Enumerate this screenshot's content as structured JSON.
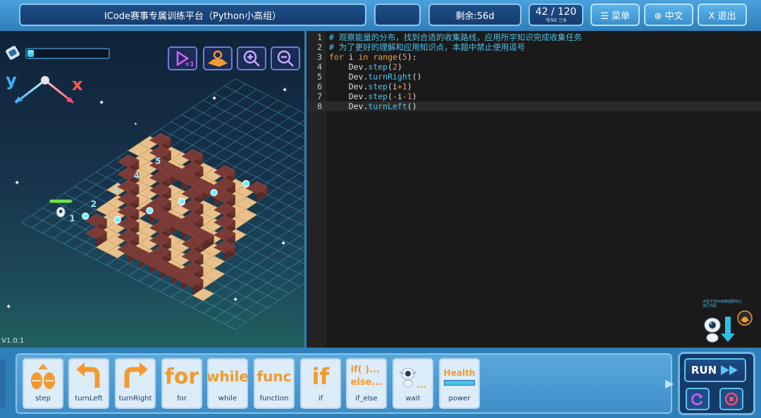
{
  "header": {
    "title": "ICode赛事专属训练平台（Python小高组）",
    "blank_label": "",
    "time_remaining": "剩余:56d",
    "progress": {
      "main": "42 / 120",
      "sub": "今50  三6"
    },
    "menu_label": "☰ 菜单",
    "lang_label": "⊕ 中文",
    "exit_label": "X 退出"
  },
  "game": {
    "energy_fraction": 0.08,
    "axis_x": "x",
    "axis_y": "y",
    "version": "V1.0.1",
    "controls": [
      "speed-icon",
      "map-icon",
      "zoom-in-icon",
      "zoom-out-icon"
    ],
    "row_labels": [
      "1",
      "2",
      "3",
      "4",
      "5"
    ]
  },
  "editor": {
    "lines": [
      {
        "n": "1",
        "parts": [
          {
            "t": "# 观察能量的分布，找到合适的收集路线，应用所学知识完成收集任务",
            "c": "c-comment"
          }
        ]
      },
      {
        "n": "2",
        "parts": [
          {
            "t": "# 为了更好的理解和应用知识点，本题中禁止使用逗号",
            "c": "c-comment"
          }
        ]
      },
      {
        "n": "3",
        "parts": [
          {
            "t": "for",
            "c": "c-kw"
          },
          {
            "t": " i ",
            "c": "c-obj"
          },
          {
            "t": "in",
            "c": "c-kw"
          },
          {
            "t": " ",
            "c": "c-obj"
          },
          {
            "t": "range",
            "c": "c-kw"
          },
          {
            "t": "(",
            "c": "c-obj"
          },
          {
            "t": "5",
            "c": "c-num"
          },
          {
            "t": "):",
            "c": "c-obj"
          }
        ]
      },
      {
        "n": "4",
        "parts": [
          {
            "t": "    Dev.",
            "c": "c-obj"
          },
          {
            "t": "step",
            "c": "c-fn"
          },
          {
            "t": "(",
            "c": "c-obj"
          },
          {
            "t": "2",
            "c": "c-num"
          },
          {
            "t": ")",
            "c": "c-obj"
          }
        ]
      },
      {
        "n": "5",
        "parts": [
          {
            "t": "    Dev.",
            "c": "c-obj"
          },
          {
            "t": "turnRight",
            "c": "c-fn"
          },
          {
            "t": "()",
            "c": "c-obj"
          }
        ]
      },
      {
        "n": "6",
        "parts": [
          {
            "t": "    Dev.",
            "c": "c-obj"
          },
          {
            "t": "step",
            "c": "c-fn"
          },
          {
            "t": "(i",
            "c": "c-obj"
          },
          {
            "t": "+",
            "c": "c-op"
          },
          {
            "t": "1",
            "c": "c-num"
          },
          {
            "t": ")",
            "c": "c-obj"
          }
        ]
      },
      {
        "n": "7",
        "parts": [
          {
            "t": "    Dev.",
            "c": "c-obj"
          },
          {
            "t": "step",
            "c": "c-fn"
          },
          {
            "t": "(",
            "c": "c-obj"
          },
          {
            "t": "-",
            "c": "c-op"
          },
          {
            "t": "i",
            "c": "c-obj"
          },
          {
            "t": "-",
            "c": "c-op"
          },
          {
            "t": "1",
            "c": "c-num"
          },
          {
            "t": ")",
            "c": "c-obj"
          }
        ]
      },
      {
        "n": "8",
        "parts": [
          {
            "t": "    Dev.",
            "c": "c-obj"
          },
          {
            "t": "turnLeft",
            "c": "c-fn"
          },
          {
            "t": "()",
            "c": "c-obj"
          }
        ]
      }
    ],
    "active_line": "8",
    "helper_text": "点击下方RUN按钮即可以运行代码"
  },
  "palette": {
    "blocks": [
      {
        "id": "step",
        "art": "",
        "label": "step"
      },
      {
        "id": "turnLeft",
        "art": "",
        "label": "turnLeft"
      },
      {
        "id": "turnRight",
        "art": "",
        "label": "turnRight"
      },
      {
        "id": "for",
        "art": "for",
        "label": "for"
      },
      {
        "id": "while",
        "art": "while",
        "label": "while"
      },
      {
        "id": "function",
        "art": "func",
        "label": "function"
      },
      {
        "id": "if",
        "art": "if",
        "label": "if"
      },
      {
        "id": "if_else",
        "art": "if( )...\nelse...",
        "label": "if_else"
      },
      {
        "id": "wait",
        "art": "",
        "label": "wait"
      },
      {
        "id": "power",
        "art": "Health",
        "label": "power"
      }
    ],
    "run_label": "RUN"
  },
  "colors": {
    "accent": "#4fc1e9",
    "orange": "#f39a2e",
    "brick": "#7a3b36",
    "tile": "#e8c08a"
  }
}
